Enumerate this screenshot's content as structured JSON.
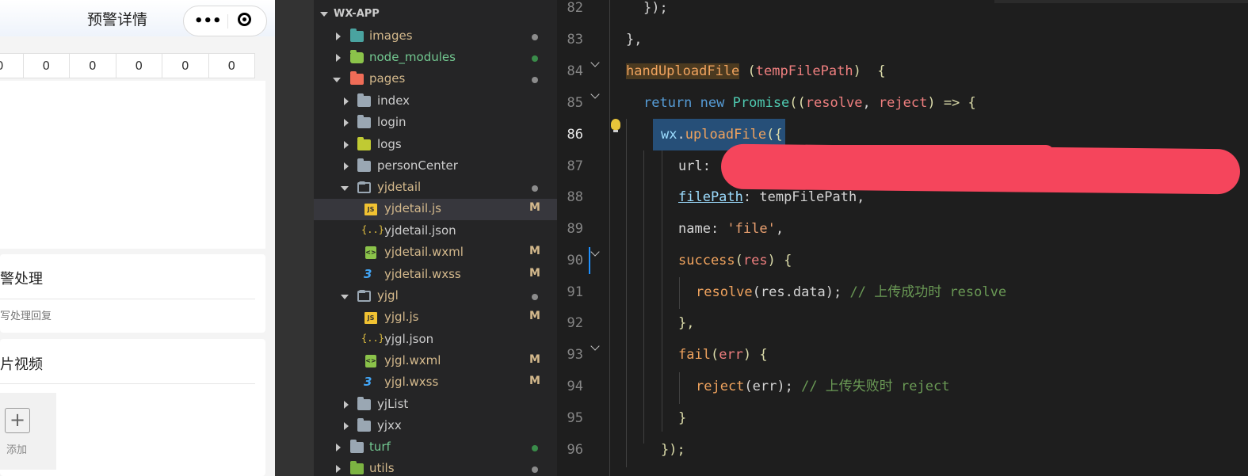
{
  "phone": {
    "nav_title": "预警详情",
    "capsule_more": "•••",
    "stats": [
      "0",
      "0",
      "0",
      "0",
      "0",
      "0"
    ],
    "card_handle_title": "警处理",
    "card_handle_hint": "写处理回复",
    "card_media_title": "片视频",
    "upload_plus": "+",
    "upload_label": "添加"
  },
  "explorer": {
    "root_label": "WX-APP",
    "rows": [
      {
        "label": "images",
        "status": "dot"
      },
      {
        "label": "node_modules",
        "status": "dot-green"
      },
      {
        "label": "pages",
        "status": "dot"
      },
      {
        "label": "index",
        "status": ""
      },
      {
        "label": "login",
        "status": ""
      },
      {
        "label": "logs",
        "status": ""
      },
      {
        "label": "personCenter",
        "status": ""
      },
      {
        "label": "yjdetail",
        "status": "dot"
      },
      {
        "label": "yjdetail.js",
        "status": "M"
      },
      {
        "label": "yjdetail.json",
        "status": ""
      },
      {
        "label": "yjdetail.wxml",
        "status": "M"
      },
      {
        "label": "yjdetail.wxss",
        "status": "M"
      },
      {
        "label": "yjgl",
        "status": "dot"
      },
      {
        "label": "yjgl.js",
        "status": "M"
      },
      {
        "label": "yjgl.json",
        "status": ""
      },
      {
        "label": "yjgl.wxml",
        "status": "M"
      },
      {
        "label": "yjgl.wxss",
        "status": "M"
      },
      {
        "label": "yjList",
        "status": ""
      },
      {
        "label": "yjxx",
        "status": ""
      },
      {
        "label": "turf",
        "status": "dot-green"
      },
      {
        "label": "utils",
        "status": "dot"
      }
    ],
    "modified_badge": "M",
    "icon_js_text": "JS",
    "icon_json_text": "{..}",
    "icon_wxml_text": "<>",
    "icon_wxss_text": "3"
  },
  "editor": {
    "line_numbers": [
      "82",
      "83",
      "84",
      "85",
      "86",
      "87",
      "88",
      "89",
      "90",
      "91",
      "92",
      "93",
      "94",
      "95",
      "96"
    ],
    "current_line": "86",
    "lines": {
      "l82": "});",
      "l83": "},",
      "l84_fn": "handUploadFile",
      "l84_open": " (",
      "l84_param": "tempFilePath",
      "l84_close": ")  {",
      "l85_return": "return",
      "l85_new": "new",
      "l85_promise": "Promise",
      "l85_open": "((",
      "l85_resolve": "resolve",
      "l85_comma": ", ",
      "l85_reject": "reject",
      "l85_arrow": ") => {",
      "l86_wx": "wx",
      "l86_dot": ".",
      "l86_fn": "uploadFile",
      "l86_open": "({",
      "l87_key": "url:",
      "l88_key": "filePath",
      "l88_rest": ": tempFilePath,",
      "l89_key": "name: ",
      "l89_val": "'file'",
      "l89_comma": ",",
      "l90_fn": "success",
      "l90_open": "(",
      "l90_param": "res",
      "l90_close": ") {",
      "l91_fn": "resolve",
      "l91_args": "(res.data);",
      "l91_comment": "// 上传成功时 resolve",
      "l92": "},",
      "l93_fn": "fail",
      "l93_open": "(",
      "l93_param": "err",
      "l93_close": ") {",
      "l94_fn": "reject",
      "l94_args": "(err);",
      "l94_comment": "// 上传失败时 reject",
      "l95": "}",
      "l96": "});"
    }
  },
  "colors": {
    "redaction": "#f5455c",
    "modified": "#d4b98c",
    "keyword": "#569cd6",
    "function": "#dcdcaa",
    "comment": "#6a9955"
  }
}
